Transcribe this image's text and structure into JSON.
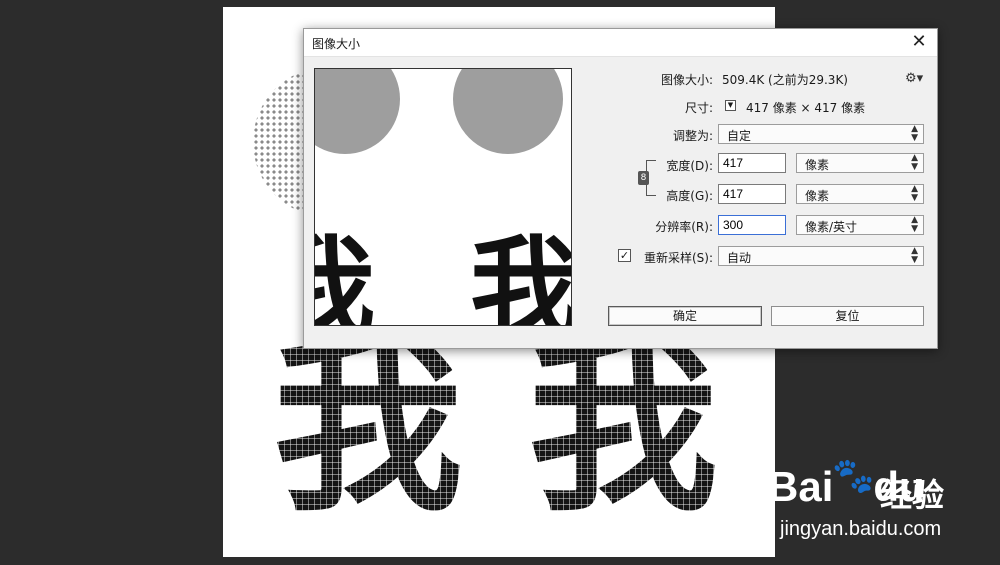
{
  "canvas": {
    "characters": [
      "我",
      "我"
    ]
  },
  "dialog": {
    "title": "图像大小",
    "close_glyph": "✕",
    "image_size_label": "图像大小:",
    "image_size_value": "509.4K (之前为29.3K)",
    "dimensions_label": "尺寸:",
    "dimensions_value": "417 像素 × 417 像素",
    "fit_to_label": "调整为:",
    "fit_to_value": "自定",
    "width_label": "宽度(D):",
    "width_value": "417",
    "width_unit": "像素",
    "height_label": "高度(G):",
    "height_value": "417",
    "height_unit": "像素",
    "resolution_label": "分辨率(R):",
    "resolution_value": "300",
    "resolution_unit": "像素/英寸",
    "resample_label": "重新采样(S):",
    "resample_checked": true,
    "resample_value": "自动",
    "ok_label": "确定",
    "reset_label": "复位",
    "preview_characters": [
      "我",
      "我"
    ]
  },
  "watermark": {
    "logo": "Bai",
    "logo_suffix": "du",
    "name": "经验",
    "url": "jingyan.baidu.com"
  },
  "icons": [
    "close-icon",
    "gear-icon",
    "chain-link-icon",
    "dropdown-arrow-icon",
    "checkmark-icon",
    "baidu-paw-icon"
  ]
}
